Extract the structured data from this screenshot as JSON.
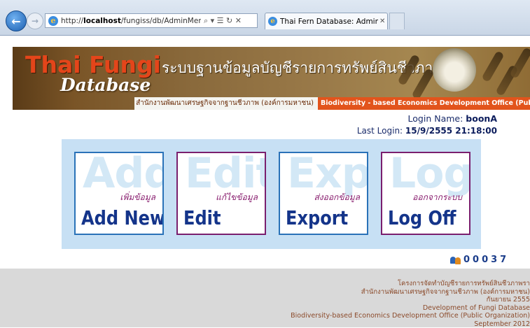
{
  "browser": {
    "url_prefix": "http://",
    "url_host": "localhost",
    "url_path": "/fungiss/db/AdminMenu.asp",
    "address_tools": "⌕ ▾ ☰ ↻ ✕",
    "tab_title": "Thai Fern Database: Admin ...",
    "tab_close": "✕"
  },
  "banner": {
    "logo_line1": "Thai Fungi",
    "logo_line2": "Database",
    "title_thai": "ระบบฐานข้อมูลบัญชีรายการทรัพย์สินชีวภาพรา",
    "org_thai": "สำนักงานพัฒนาเศรษฐกิจจากฐานชีวภาพ (องค์การมหาชน)",
    "org_english": "Biodiversity - based Economics Development Office (Public Organization)"
  },
  "login": {
    "name_label": "Login Name: ",
    "name_value": "boonA",
    "last_label": "Last Login: ",
    "last_value": "15/9/2555 21:18:00"
  },
  "menu": {
    "add": {
      "watermark": "Add",
      "thai": "เพิ่มข้อมูล",
      "label": "Add New"
    },
    "edit": {
      "watermark": "Edit",
      "thai": "แก้ไขข้อมูล",
      "label": "Edit"
    },
    "export": {
      "watermark": "Export",
      "thai": "ส่งออกข้อมูล",
      "label": "Export"
    },
    "logoff": {
      "watermark": "Log Off",
      "thai": "ออกจากระบบ",
      "label": "Log Off"
    }
  },
  "counter": {
    "value": "00037"
  },
  "footer": {
    "line1": "โครงการจัดทำบัญชีรายการทรัพย์สินชีวภาพรา",
    "line2": "สำนักงานพัฒนาเศรษฐกิจจากฐานชีวภาพ (องค์การมหาชน)",
    "line3": "กันยายน 2555",
    "line4": "Development of Fungi Database",
    "line5": "Biodiversity-based Economics Development Office (Public Organization)",
    "line6": "September 2012"
  },
  "colors": {
    "banner_orange": "#e2541c",
    "menu_panel": "#c7e0f4",
    "label_navy": "#14348a",
    "footer_gray": "#d9d9d9"
  },
  "icons": [
    "back-arrow-icon",
    "forward-arrow-icon",
    "ie-icon",
    "people-icon"
  ]
}
